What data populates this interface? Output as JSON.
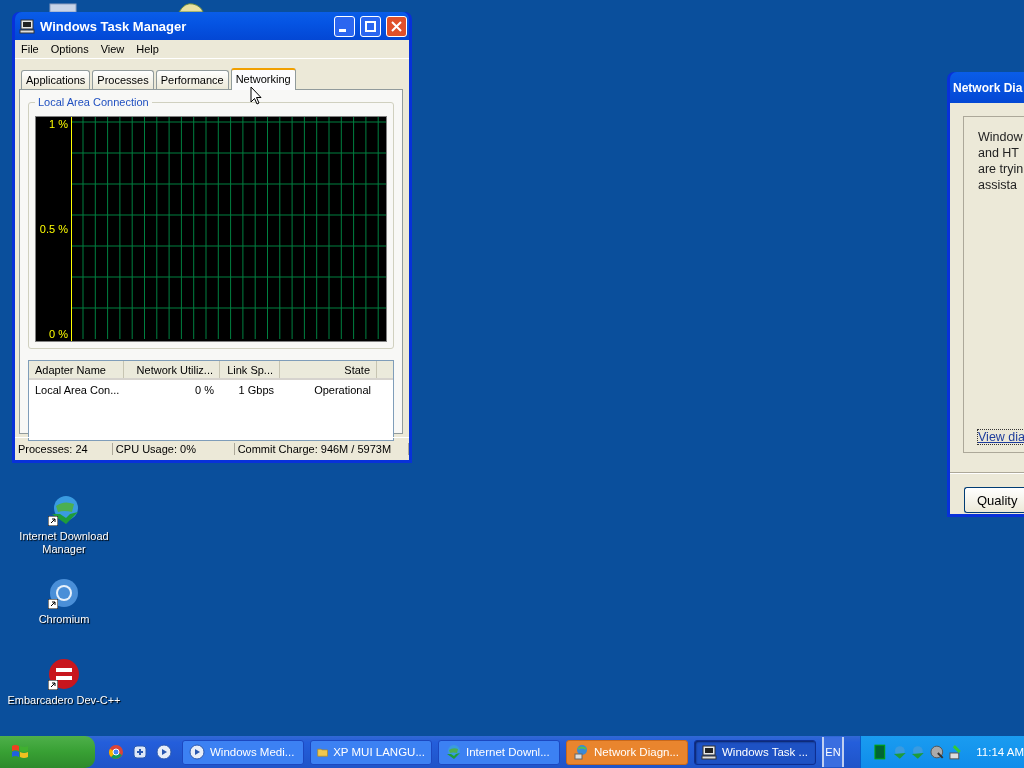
{
  "task_manager": {
    "title": "Windows Task Manager",
    "menu": [
      "File",
      "Options",
      "View",
      "Help"
    ],
    "tabs": [
      {
        "label": "Applications",
        "selected": false
      },
      {
        "label": "Processes",
        "selected": false
      },
      {
        "label": "Performance",
        "selected": false
      },
      {
        "label": "Networking",
        "selected": true
      }
    ],
    "group_title": "Local Area Connection",
    "graph_labels": [
      "1 %",
      "0.5 %",
      "0 %"
    ],
    "adapters": {
      "columns": [
        "Adapter Name",
        "Network Utiliz...",
        "Link Sp...",
        "State"
      ],
      "rows": [
        [
          "Local Area Con...",
          "0 %",
          "1 Gbps",
          "Operational"
        ]
      ]
    },
    "status_bar": [
      "Processes: 24",
      "CPU Usage: 0%",
      "Commit Charge: 946M / 5973M"
    ]
  },
  "network_diagnostics": {
    "title": "Network Dia",
    "lines": [
      "Window",
      "and HT",
      "are tryin",
      "assista"
    ],
    "link": "View dia",
    "button": "Quality"
  },
  "desktop_icons": [
    {
      "label": "Internet Download Manager",
      "kind": "globe"
    },
    {
      "label": "Chromium",
      "kind": "browser"
    },
    {
      "label": "Embarcadero Dev-C++",
      "kind": "dev"
    }
  ],
  "taskbar": {
    "tasks": [
      {
        "label": "Windows Medi...",
        "kind": "media",
        "selected": false,
        "flashing": false
      },
      {
        "label": "XP MUI LANGU...",
        "kind": "folder",
        "selected": false,
        "flashing": false
      },
      {
        "label": "Internet Downl...",
        "kind": "globe",
        "selected": false,
        "flashing": false
      },
      {
        "label": "Network Diagn...",
        "kind": "network",
        "selected": false,
        "flashing": true
      },
      {
        "label": "Windows Task ...",
        "kind": "monitor",
        "selected": true,
        "flashing": false
      }
    ],
    "language": "EN",
    "clock": "11:14 AM"
  }
}
